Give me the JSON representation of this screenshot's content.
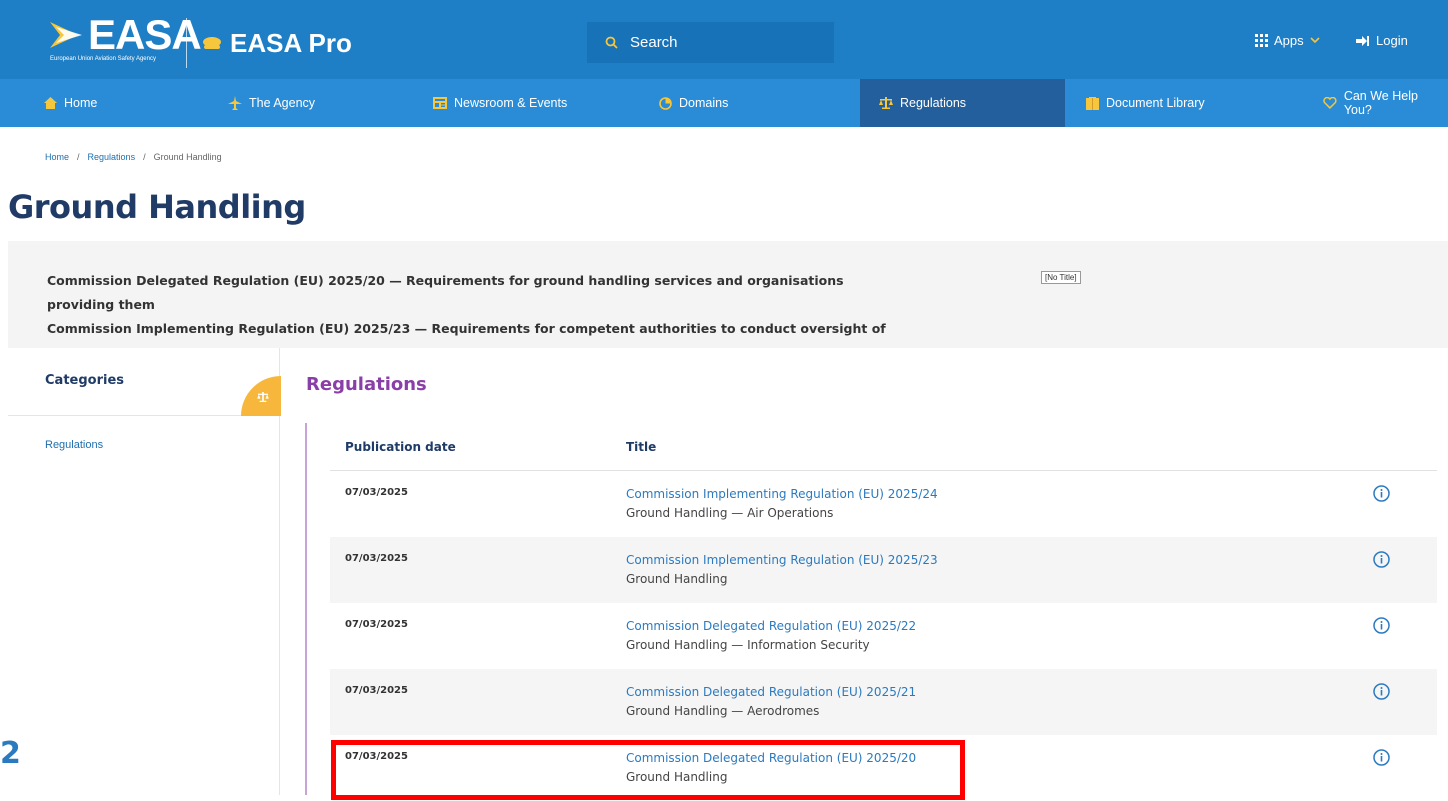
{
  "header": {
    "logo_text": "EASA",
    "logo_subtitle": "European Union Aviation Safety Agency",
    "pro_label": "EASA Pro",
    "search_label": "Search",
    "apps_label": "Apps",
    "login_label": "Login",
    "brand_color": "#1e7fc6"
  },
  "nav": {
    "items": [
      {
        "label": "Home",
        "icon": "home-icon"
      },
      {
        "label": "The Agency",
        "icon": "plane-icon"
      },
      {
        "label": "Newsroom & Events",
        "icon": "news-icon"
      },
      {
        "label": "Domains",
        "icon": "domains-icon"
      },
      {
        "label": "Regulations",
        "icon": "scales-icon",
        "active": true
      },
      {
        "label": "Document Library",
        "icon": "book-icon"
      },
      {
        "label": "Can We Help You?",
        "icon": "heart-icon"
      }
    ]
  },
  "breadcrumb": {
    "home": "Home",
    "sep": "/",
    "regulations": "Regulations",
    "current": "Ground Handling"
  },
  "page": {
    "title": "Ground Handling",
    "intro_line1": "Commission Delegated Regulation (EU) 2025/20 — Requirements for ground handling services and organisations",
    "intro_line2": "providing them",
    "intro_line3": "Commission Implementing Regulation (EU) 2025/23 — Requirements for competent authorities to conduct oversight of",
    "no_title": "[No Title]"
  },
  "sidebar": {
    "title": "Categories",
    "link": "Regulations"
  },
  "regulations": {
    "heading": "Regulations",
    "col_date": "Publication date",
    "col_title": "Title",
    "rows": [
      {
        "date": "07/03/2025",
        "title": "Commission Implementing Regulation (EU) 2025/24",
        "subtitle": "Ground Handling — Air Operations"
      },
      {
        "date": "07/03/2025",
        "title": "Commission Implementing Regulation (EU) 2025/23",
        "subtitle": "Ground Handling"
      },
      {
        "date": "07/03/2025",
        "title": "Commission Delegated Regulation (EU) 2025/22",
        "subtitle": "Ground Handling — Information Security"
      },
      {
        "date": "07/03/2025",
        "title": "Commission Delegated Regulation (EU) 2025/21",
        "subtitle": "Ground Handling — Aerodromes"
      },
      {
        "date": "07/03/2025",
        "title": "Commission Delegated Regulation (EU) 2025/20",
        "subtitle": "Ground Handling"
      }
    ]
  },
  "edge_glyph": "2",
  "highlight_color": "#ff0000"
}
